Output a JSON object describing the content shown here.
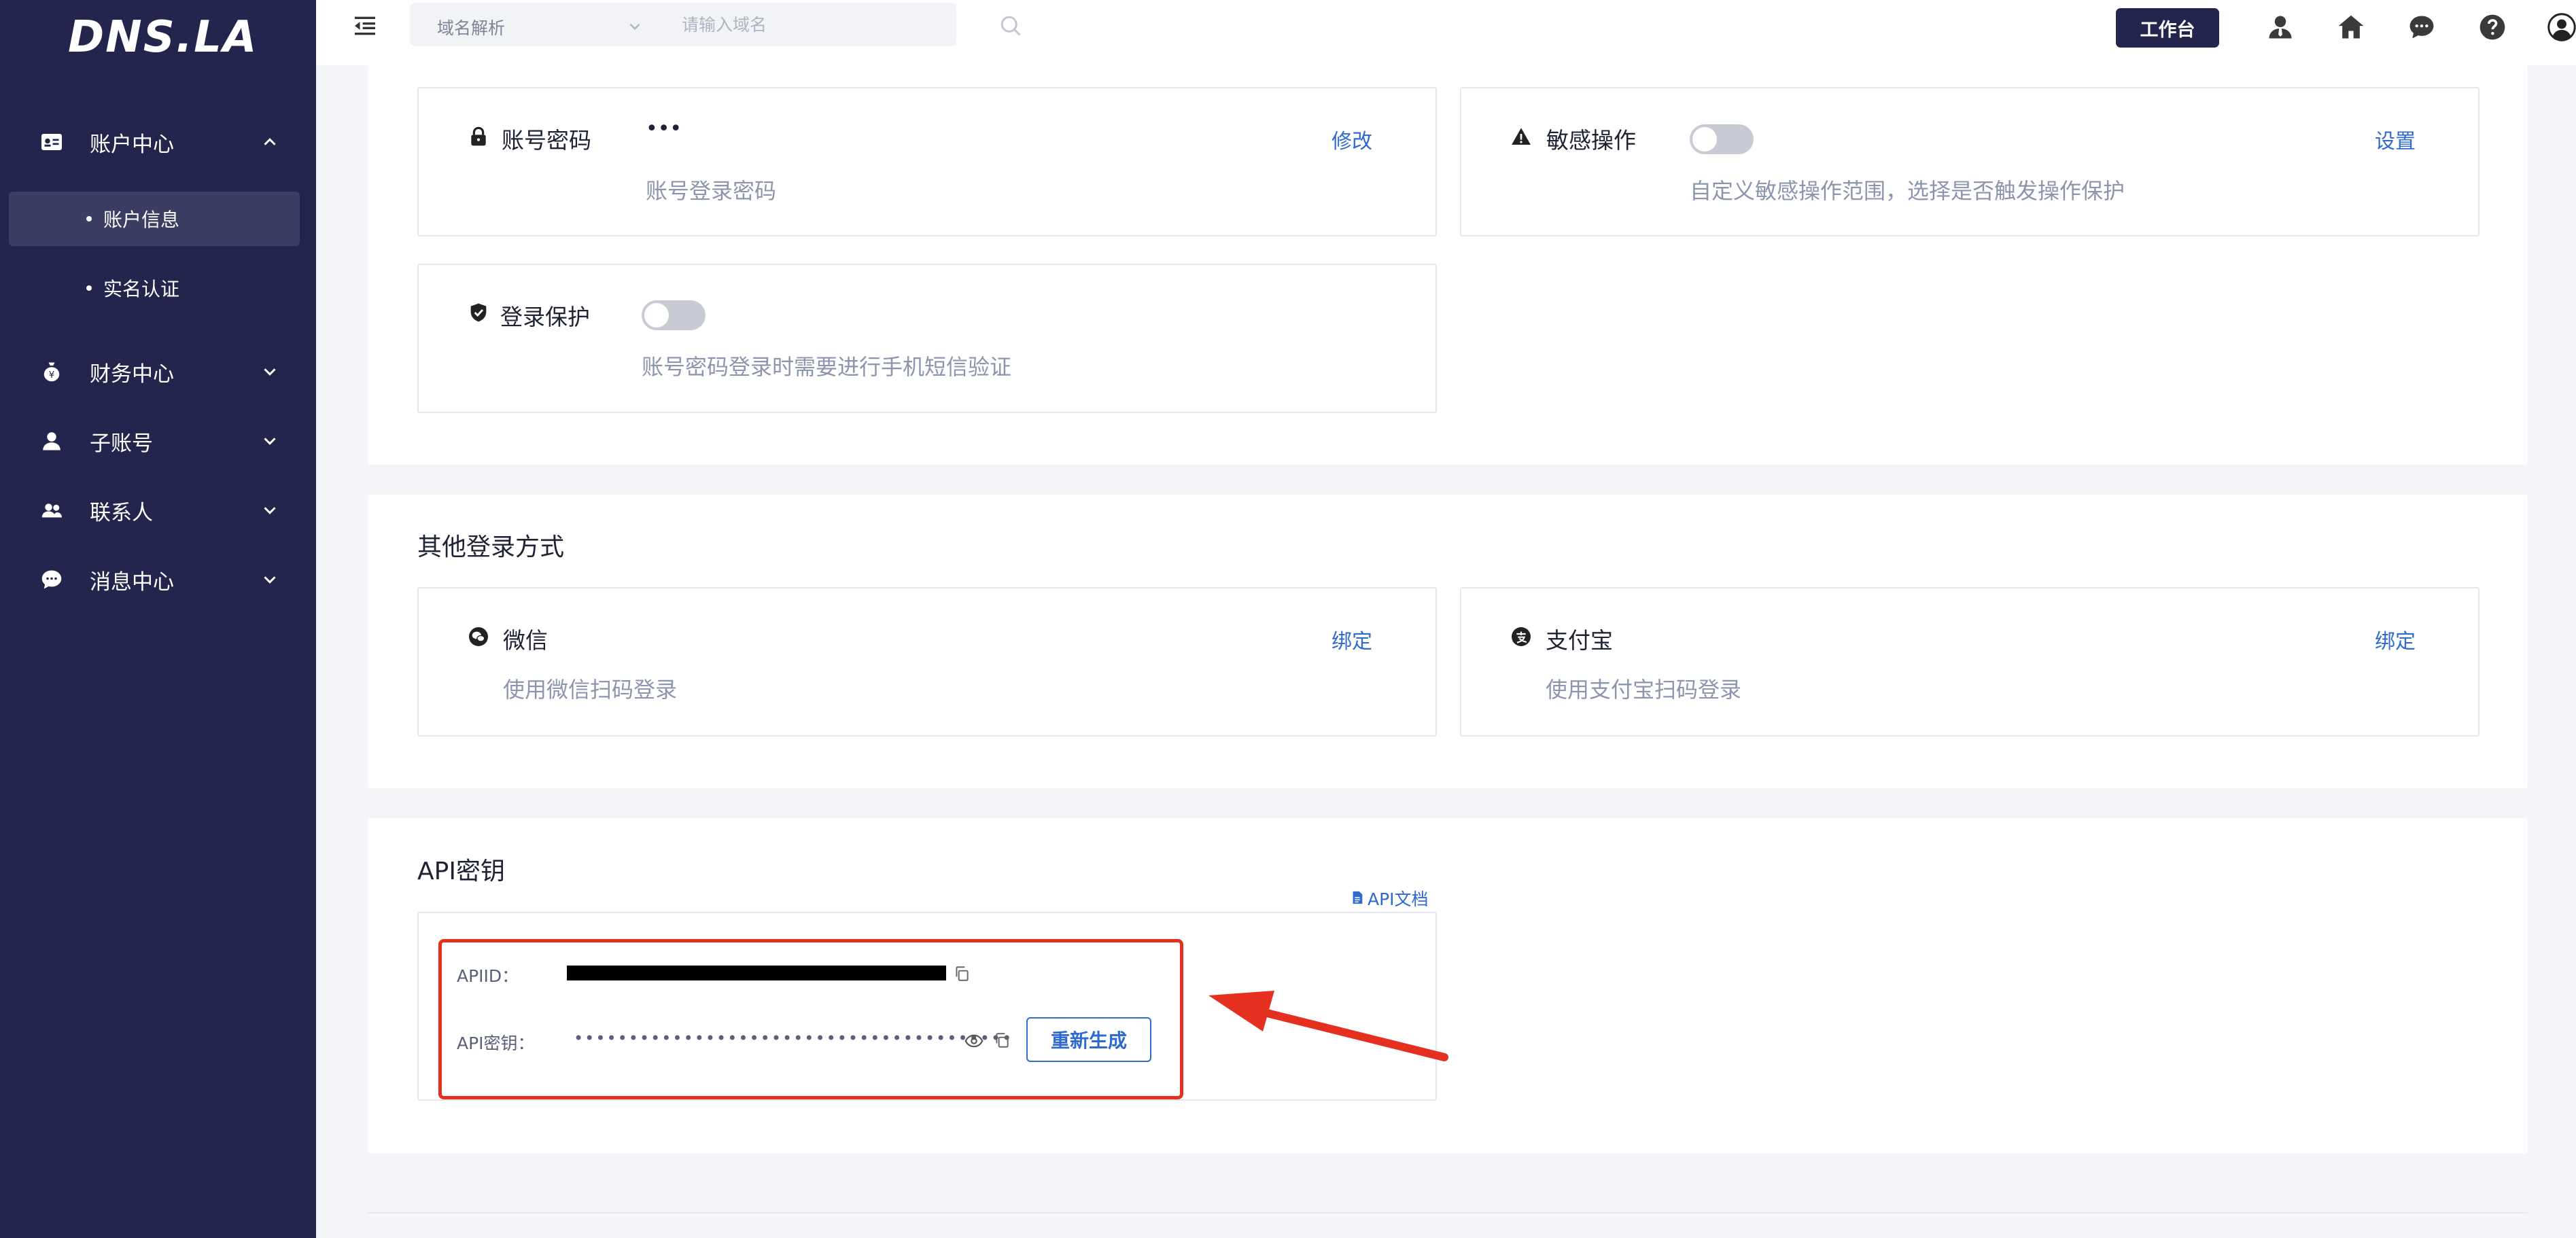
{
  "brand": {
    "logo_text": "DNS.LA"
  },
  "sidebar": {
    "groups": [
      {
        "label": "账户中心",
        "icon": "id-card-icon",
        "expanded": true
      },
      {
        "label": "财务中心",
        "icon": "money-bag-icon",
        "expanded": false
      },
      {
        "label": "子账号",
        "icon": "user-icon",
        "expanded": false
      },
      {
        "label": "联系人",
        "icon": "contacts-icon",
        "expanded": false
      },
      {
        "label": "消息中心",
        "icon": "chat-bubble-icon",
        "expanded": false
      }
    ],
    "account_sub_items": [
      {
        "label": "账户信息",
        "active": true
      },
      {
        "label": "实名认证",
        "active": false
      }
    ]
  },
  "topbar": {
    "search_type": "域名解析",
    "search_placeholder": "请输入域名",
    "workbench_label": "工作台",
    "icons": [
      "user-icon",
      "home-icon",
      "chat-icon",
      "help-icon",
      "avatar-icon"
    ]
  },
  "security": {
    "password": {
      "title": "账号密码",
      "value": "•••",
      "desc": "账号登录密码",
      "action": "修改"
    },
    "sensitive": {
      "title": "敏感操作",
      "desc": "自定义敏感操作范围，选择是否触发操作保护",
      "action": "设置",
      "enabled": false
    },
    "login_protect": {
      "title": "登录保护",
      "desc": "账号密码登录时需要进行手机短信验证",
      "enabled": false
    }
  },
  "other_login": {
    "title": "其他登录方式",
    "wechat": {
      "title": "微信",
      "desc": "使用微信扫码登录",
      "action": "绑定"
    },
    "alipay": {
      "title": "支付宝",
      "desc": "使用支付宝扫码登录",
      "action": "绑定"
    }
  },
  "api": {
    "title": "API密钥",
    "doc_link": "API文档",
    "id_label": "APIID：",
    "key_label": "API密钥：",
    "key_masked": "••••••••••••••••••••••••••••••••••••••••",
    "regen_label": "重新生成"
  },
  "colors": {
    "sidebar_bg": "#24254c",
    "accent": "#2e6ad0",
    "annotation_red": "#e5301f"
  }
}
